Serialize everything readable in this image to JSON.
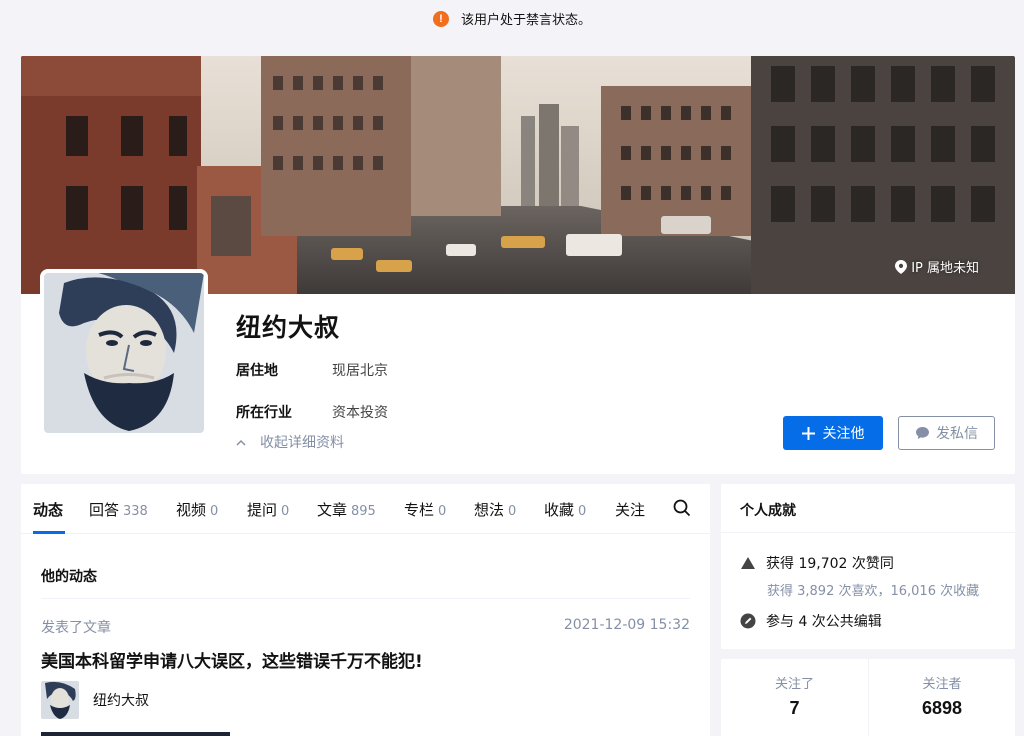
{
  "notice": {
    "icon": "exclamation-icon",
    "text": "该用户处于禁言状态。"
  },
  "profile": {
    "ip_location": "IP 属地未知",
    "name": "纽约大叔",
    "residence_label": "居住地",
    "residence_value": "现居北京",
    "industry_label": "所在行业",
    "industry_value": "资本投资",
    "collapse_label": "收起详细资料",
    "follow_button": "关注他",
    "message_button": "发私信"
  },
  "tabs": [
    {
      "label": "动态",
      "count": ""
    },
    {
      "label": "回答",
      "count": "338"
    },
    {
      "label": "视频",
      "count": "0"
    },
    {
      "label": "提问",
      "count": "0"
    },
    {
      "label": "文章",
      "count": "895"
    },
    {
      "label": "专栏",
      "count": "0"
    },
    {
      "label": "想法",
      "count": "0"
    },
    {
      "label": "收藏",
      "count": "0"
    },
    {
      "label": "关注",
      "count": ""
    }
  ],
  "feed": {
    "section_title": "他的动态",
    "activity_type": "发表了文章",
    "activity_time": "2021-12-09 15:32",
    "article_title": "美国本科留学申请八大误区，这些错误千万不能犯!",
    "author_name": "纽约大叔"
  },
  "achievements": {
    "title": "个人成就",
    "likes": "获得 19,702 次赞同",
    "likes_sub": "获得 3,892 次喜欢，16,016 次收藏",
    "edits": "参与 4 次公共编辑"
  },
  "follow_stats": {
    "following_label": "关注了",
    "following_value": "7",
    "followers_label": "关注者",
    "followers_value": "6898"
  },
  "colors": {
    "accent": "#056de8",
    "notice": "#f06e1d",
    "muted": "#8590a6"
  }
}
